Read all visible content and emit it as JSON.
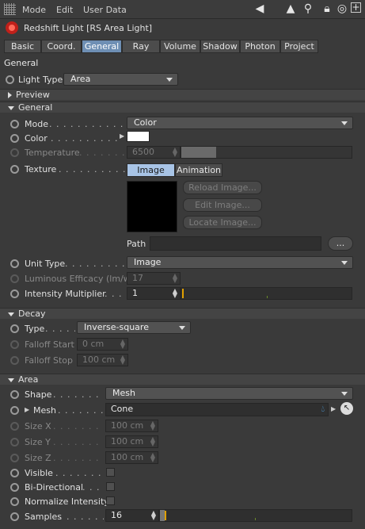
{
  "menu": {
    "mode": "Mode",
    "edit": "Edit",
    "user_data": "User Data"
  },
  "object_title": "Redshift Light [RS Area Light]",
  "tabs": [
    "Basic",
    "Coord.",
    "General",
    "Ray",
    "Volume",
    "Shadow",
    "Photon",
    "Project"
  ],
  "active_tab": "General",
  "general_header": "General",
  "light_type": {
    "label": "Light Type",
    "value": "Area"
  },
  "preview_header": "Preview",
  "general_group": {
    "title": "General",
    "mode": {
      "label": "Mode",
      "value": "Color"
    },
    "color": {
      "label": "Color",
      "swatch": "#ffffff"
    },
    "temperature": {
      "label": "Temperature",
      "value": "6500"
    },
    "texture": {
      "label": "Texture",
      "tab_image": "Image",
      "tab_animation": "Animation",
      "reload": "Reload Image...",
      "edit": "Edit Image...",
      "locate": "Locate Image...",
      "path_label": "Path",
      "browse": "..."
    },
    "unit_type": {
      "label": "Unit Type",
      "value": "Image"
    },
    "luminous_efficacy": {
      "label": "Luminous Efficacy (lm/w)",
      "value": "17"
    },
    "intensity": {
      "label": "Intensity Multiplier",
      "value": "1",
      "fraction": 0.0
    }
  },
  "decay": {
    "title": "Decay",
    "type": {
      "label": "Type",
      "value": "Inverse-square"
    },
    "falloff_start": {
      "label": "Falloff Start",
      "value": "0 cm"
    },
    "falloff_stop": {
      "label": "Falloff Stop",
      "value": "100 cm"
    }
  },
  "area": {
    "title": "Area",
    "shape": {
      "label": "Shape",
      "value": "Mesh"
    },
    "mesh": {
      "label": "Mesh",
      "value": "Cone"
    },
    "size_x": {
      "label": "Size X",
      "value": "100 cm"
    },
    "size_y": {
      "label": "Size Y",
      "value": "100 cm"
    },
    "size_z": {
      "label": "Size Z",
      "value": "100 cm"
    },
    "visible": {
      "label": "Visible",
      "checked": false
    },
    "bi_directional": {
      "label": "Bi-Directional",
      "checked": false
    },
    "normalize_intensity": {
      "label": "Normalize Intensity",
      "checked": false
    },
    "samples": {
      "label": "Samples",
      "value": "16"
    }
  },
  "colors": {
    "accent": "#6e8fb4",
    "slider_marker": "#e0a000",
    "panel": "#3a3a3a"
  }
}
